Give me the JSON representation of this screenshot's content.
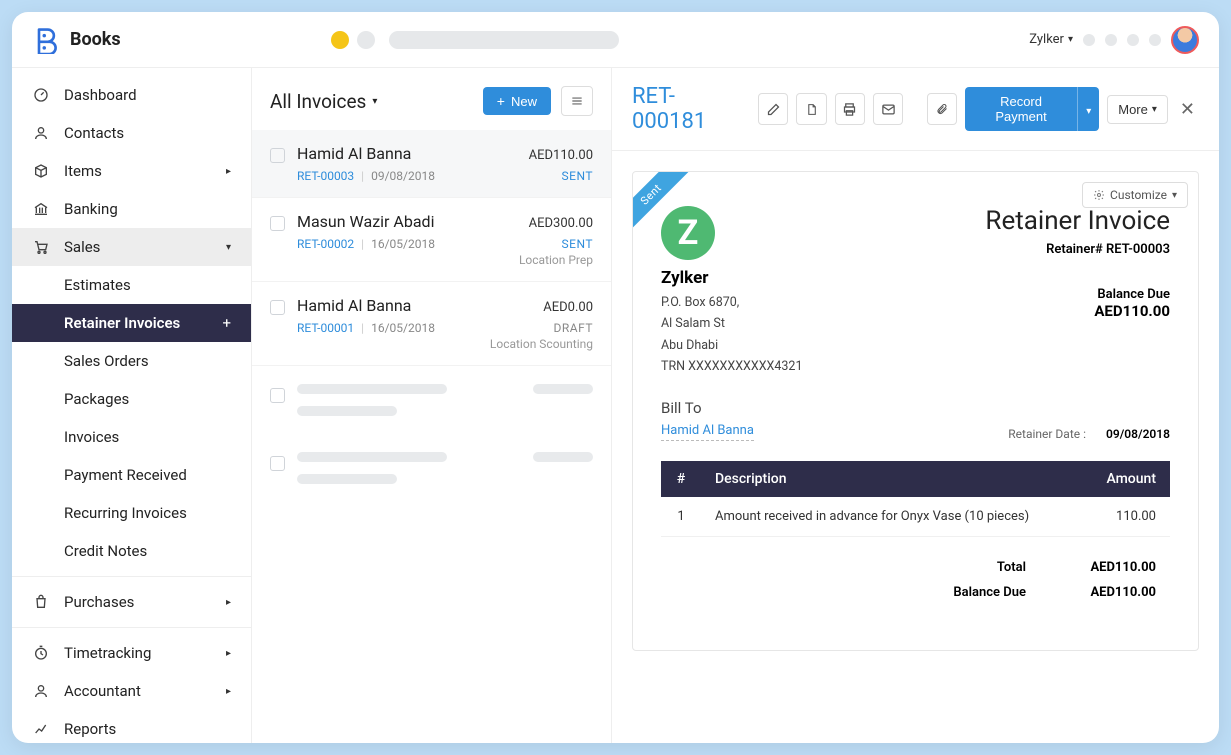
{
  "header": {
    "app_name": "Books",
    "org_name": "Zylker"
  },
  "sidebar": {
    "items": [
      {
        "label": "Dashboard",
        "icon": "dashboard"
      },
      {
        "label": "Contacts",
        "icon": "contacts"
      },
      {
        "label": "Items",
        "icon": "items",
        "caret": true
      },
      {
        "label": "Banking",
        "icon": "banking"
      }
    ],
    "sales": {
      "label": "Sales",
      "sub": [
        {
          "label": "Estimates"
        },
        {
          "label": "Retainer Invoices",
          "active": true
        },
        {
          "label": "Sales Orders"
        },
        {
          "label": "Packages"
        },
        {
          "label": "Invoices"
        },
        {
          "label": "Payment Received"
        },
        {
          "label": "Recurring Invoices"
        },
        {
          "label": "Credit Notes"
        }
      ]
    },
    "after": [
      {
        "label": "Purchases",
        "icon": "purchases",
        "caret": true
      },
      {
        "label": "Timetracking",
        "icon": "timetracking",
        "caret": true
      },
      {
        "label": "Accountant",
        "icon": "accountant",
        "caret": true
      },
      {
        "label": "Reports",
        "icon": "reports"
      }
    ]
  },
  "listcol": {
    "title": "All Invoices",
    "new_label": "New",
    "rows": [
      {
        "name": "Hamid Al Banna",
        "amount": "AED110.00",
        "ref": "RET-00003",
        "date": "09/08/2018",
        "status": "SENT",
        "note": "",
        "highlight": true
      },
      {
        "name": "Masun Wazir Abadi",
        "amount": "AED300.00",
        "ref": "RET-00002",
        "date": "16/05/2018",
        "status": "SENT",
        "note": "Location Prep"
      },
      {
        "name": "Hamid Al Banna",
        "amount": "AED0.00",
        "ref": "RET-00001",
        "date": "16/05/2018",
        "status": "DRAFT",
        "note": "Location Scounting"
      }
    ]
  },
  "detail": {
    "title": "RET-000181",
    "record_payment": "Record Payment",
    "more": "More",
    "customize": "Customize",
    "ribbon": "Sent",
    "company": {
      "logo_letter": "Z",
      "name": "Zylker",
      "addr1": "P.O. Box 6870,",
      "addr2": "Al Salam St",
      "addr3": "Abu Dhabi",
      "trn": "TRN XXXXXXXXXXX4321"
    },
    "doc_type": "Retainer Invoice",
    "doc_num": "Retainer# RET-00003",
    "balance_due_label": "Balance Due",
    "balance_due": "AED110.00",
    "bill_to_label": "Bill To",
    "bill_to_name": "Hamid Al Banna",
    "retainer_date_label": "Retainer Date :",
    "retainer_date": "09/08/2018",
    "table": {
      "h_num": "#",
      "h_desc": "Description",
      "h_amt": "Amount",
      "rows": [
        {
          "n": "1",
          "desc": "Amount received in advance for Onyx Vase (10 pieces)",
          "amt": "110.00"
        }
      ]
    },
    "totals": {
      "total_label": "Total",
      "total": "AED110.00",
      "bal_label": "Balance Due",
      "bal": "AED110.00"
    }
  }
}
